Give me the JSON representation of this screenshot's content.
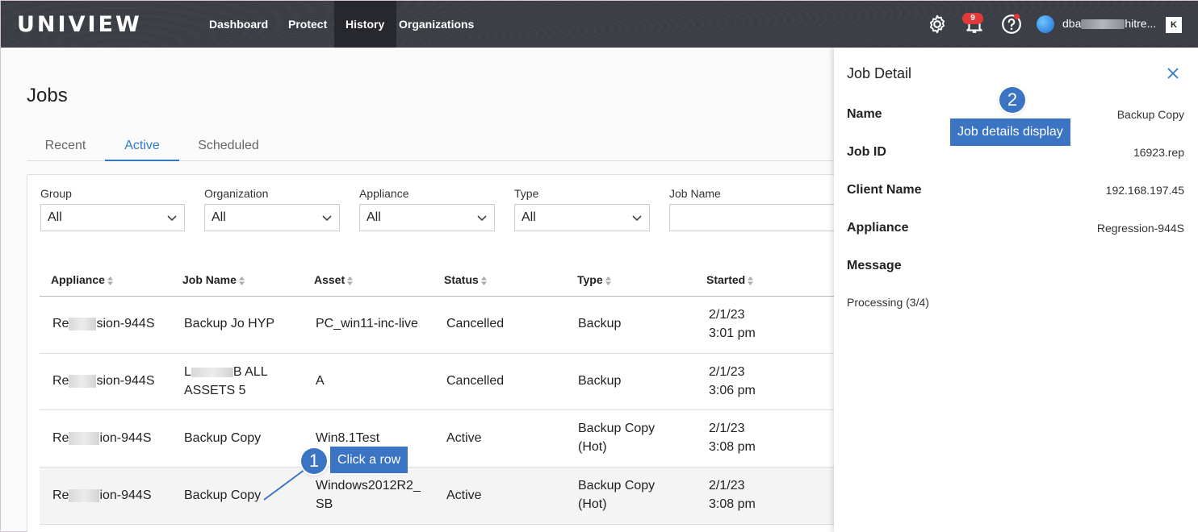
{
  "nav": {
    "logo": "UNIVIEW",
    "items": [
      "Dashboard",
      "Protect",
      "History",
      "Organizations"
    ],
    "active": "History",
    "notification_count": "9",
    "username_start": "dba",
    "username_end": "hitre..."
  },
  "page": {
    "title": "Jobs",
    "tabs": [
      "Recent",
      "Active",
      "Scheduled"
    ],
    "active_tab": "Active"
  },
  "filters": [
    {
      "label": "Group",
      "value": "All"
    },
    {
      "label": "Organization",
      "value": "All"
    },
    {
      "label": "Appliance",
      "value": "All"
    },
    {
      "label": "Type",
      "value": "All"
    },
    {
      "label": "Job Name",
      "value": ""
    }
  ],
  "table": {
    "columns": [
      "Appliance",
      "Job Name",
      "Asset",
      "Status",
      "Type",
      "Started"
    ],
    "rows": [
      {
        "appliance_a": "Re",
        "appliance_b": "sion-944S",
        "job_line1": "Backup Jo HYP",
        "job_line2": "",
        "asset_line1": "PC_win11-inc-live",
        "asset_line2": "",
        "status": "Cancelled",
        "type_line1": "Backup",
        "type_line2": "",
        "date": "2/1/23",
        "time": "3:01 pm"
      },
      {
        "appliance_a": "Re",
        "appliance_b": "sion-944S",
        "job_line1": "L",
        "job_line1b": "B ALL",
        "job_line2": "ASSETS 5",
        "asset_line1": "A",
        "asset_line2": "",
        "status": "Cancelled",
        "type_line1": "Backup",
        "type_line2": "",
        "date": "2/1/23",
        "time": "3:06 pm"
      },
      {
        "appliance_a": "Re",
        "appliance_b": "ion-944S",
        "job_line1": "Backup Copy",
        "job_line2": "",
        "asset_line1": "Win8.1Test",
        "asset_line2": "",
        "status": "Active",
        "type_line1": "Backup Copy",
        "type_line2": "(Hot)",
        "date": "2/1/23",
        "time": "3:08 pm"
      },
      {
        "appliance_a": "Re",
        "appliance_b": "ion-944S",
        "job_line1": "Backup Copy",
        "job_line2": "",
        "asset_line1": "Windows2012R2_",
        "asset_line2": "SB",
        "status": "Active",
        "type_line1": "Backup Copy",
        "type_line2": "(Hot)",
        "date": "2/1/23",
        "time": "3:08 pm"
      }
    ]
  },
  "job_detail": {
    "title": "Job Detail",
    "fields": [
      {
        "key": "Name",
        "value": "Backup Copy"
      },
      {
        "key": "Job ID",
        "value": "16923.rep"
      },
      {
        "key": "Client Name",
        "value": "192.168.197.45"
      },
      {
        "key": "Appliance",
        "value": "Regression-944S"
      },
      {
        "key": "Message",
        "value": ""
      }
    ],
    "message": "Processing (3/4)"
  },
  "callouts": [
    {
      "number": "1",
      "text": "Click a row"
    },
    {
      "number": "2",
      "text": "Job details display"
    }
  ],
  "colors": {
    "accent": "#2f7bc5",
    "callout": "#3a74c2",
    "nav_bg": "#3b3e45"
  }
}
